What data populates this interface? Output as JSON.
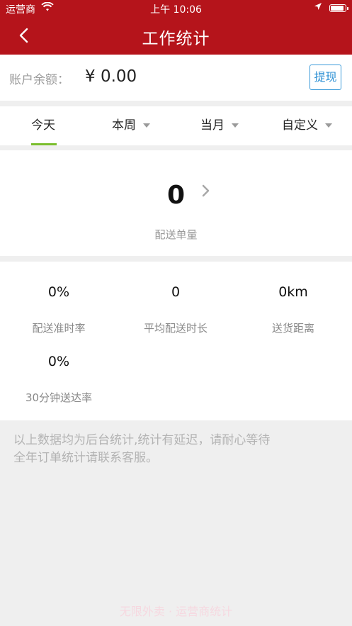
{
  "status_bar": {
    "carrier": "运营商",
    "time": "上午 10:06"
  },
  "nav": {
    "title": "工作统计",
    "back_icon": "chevron-left-icon"
  },
  "balance": {
    "label": "账户余额：",
    "value": "¥ 0.00",
    "withdraw_label": "提现"
  },
  "tabs": [
    {
      "label": "今天",
      "active": true
    },
    {
      "label": "本周",
      "has_dropdown": true
    },
    {
      "label": "当月",
      "has_dropdown": true
    },
    {
      "label": "自定义",
      "has_dropdown": true
    }
  ],
  "orders": {
    "value": "0",
    "label": "配送单量"
  },
  "stats": [
    {
      "value": "0%",
      "label": "配送准时率"
    },
    {
      "value": "0",
      "label": "平均配送时长"
    },
    {
      "value": "0km",
      "label": "送货距离"
    },
    {
      "value": "0%",
      "label": "30分钟送达率"
    }
  ],
  "note": {
    "line1": "以上数据均为后台统计,统计有延迟，请耐心等待",
    "line2": "全年订单统计请联系客服。"
  },
  "watermark": "无限外卖 · 运营商统计",
  "colors": {
    "brand_red": "#b5141b",
    "tab_accent": "#7bbe2e",
    "link_blue": "#2b8fd4"
  }
}
